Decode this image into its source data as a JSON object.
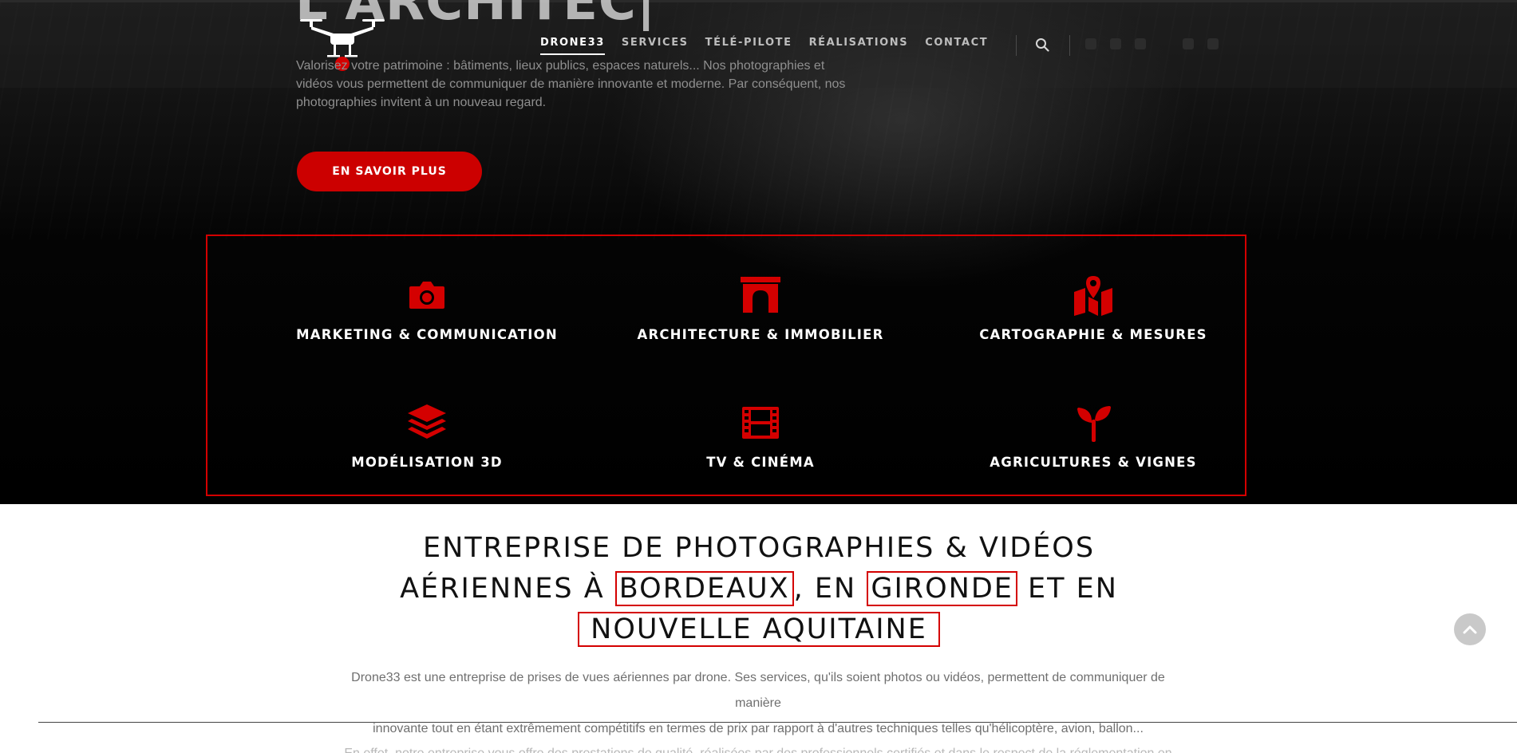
{
  "hero": {
    "title": "L'ARCHITEC|",
    "text": "Valorisez votre patrimoine : bâtiments, lieux publics, espaces naturels... Nos photographies et vidéos vous permettent de communiquer de manière innovante et moderne. Par conséquent, nos photographies invitent à un nouveau regard.",
    "cta_label": "EN SAVOIR PLUS"
  },
  "nav": {
    "items": [
      "DRONE33",
      "SERVICES",
      "TÉLÉ-PILOTE",
      "RÉALISATIONS",
      "CONTACT"
    ],
    "active_index": 0
  },
  "services": [
    {
      "label": "MARKETING & COMMUNICATION",
      "icon": "camera-icon"
    },
    {
      "label": "ARCHITECTURE & IMMOBILIER",
      "icon": "arch-icon"
    },
    {
      "label": "CARTOGRAPHIE & MESURES",
      "icon": "map-pin-icon"
    },
    {
      "label": "MODÉLISATION 3D",
      "icon": "layers-icon"
    },
    {
      "label": "TV & CINÉMA",
      "icon": "film-icon"
    },
    {
      "label": "AGRICULTURES & VIGNES",
      "icon": "seedling-icon"
    }
  ],
  "headline": {
    "part1": "ENTREPRISE DE PHOTOGRAPHIES & VIDÉOS AÉRIENNES À ",
    "city": "BORDEAUX",
    "part2": ", EN ",
    "dept": "GIRONDE",
    "part3": " ET EN",
    "region": "NOUVELLE AQUITAINE"
  },
  "description": {
    "line1": "Drone33 est une entreprise de prises de vues aériennes par drone. Ses services, qu'ils soient photos ou vidéos, permettent de communiquer de manière",
    "line2": "innovante tout en étant extrêmement compétitifs en termes de prix par rapport à d'autres techniques telles qu'hélicoptère, avion, ballon...",
    "line3": "En effet, notre entreprise vous offre des prestations de qualité, réalisées par des professionnels certifiés et dans le respect de la réglementation en vigueur."
  },
  "colors": {
    "accent": "#cc0000",
    "box_border": "#d40000",
    "hero_bg": "#000000"
  }
}
